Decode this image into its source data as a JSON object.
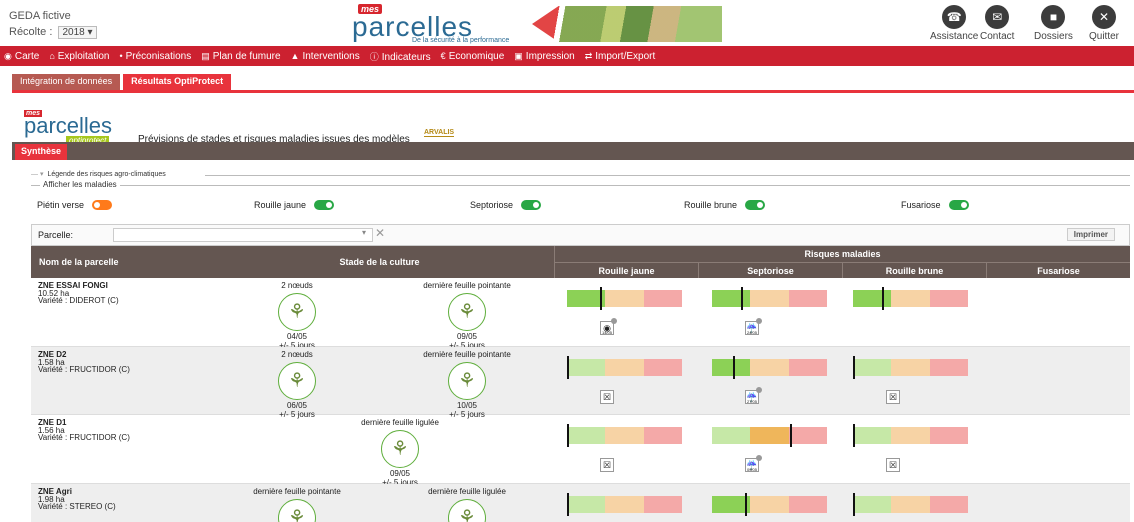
{
  "header": {
    "org": "GEDA fictive",
    "harvest_label": "Récolte :",
    "harvest_value": "2018",
    "brand_mes": "mes",
    "brand_name": "parcelles",
    "tagline": "De la sécurité à la performance",
    "tools": [
      {
        "label": "Assistance",
        "icon": "phone-icon"
      },
      {
        "label": "Contact",
        "icon": "mail-icon"
      },
      {
        "label": "Dossiers",
        "icon": "folder-icon"
      },
      {
        "label": "Quitter",
        "icon": "close-icon"
      }
    ]
  },
  "nav": [
    {
      "label": "Carte",
      "icon": "map-pin-icon"
    },
    {
      "label": "Exploitation",
      "icon": "home-icon"
    },
    {
      "label": "Préconisations",
      "icon": "pin-icon"
    },
    {
      "label": "Plan de fumure",
      "icon": "plan-icon"
    },
    {
      "label": "Interventions",
      "icon": "tractor-icon"
    },
    {
      "label": "Indicateurs",
      "icon": "info-icon"
    },
    {
      "label": "Economique",
      "icon": "euro-icon"
    },
    {
      "label": "Impression",
      "icon": "print-icon"
    },
    {
      "label": "Import/Export",
      "icon": "export-icon"
    }
  ],
  "subtabs": [
    "Intégration de données",
    "Résultats OptiProtect"
  ],
  "opti": {
    "badge": "optiprotect",
    "description": "Prévisions de stades et risques maladies issues des modèles",
    "partner": "ARVALIS"
  },
  "synth_tab": "Synthèse",
  "legend_label": "Légende des risques agro-climatiques",
  "afficher_label": "Afficher les maladies",
  "diseases_toggles": [
    {
      "label": "Piétin verse",
      "on": false
    },
    {
      "label": "Rouille jaune",
      "on": true
    },
    {
      "label": "Septoriose",
      "on": true
    },
    {
      "label": "Rouille brune",
      "on": true
    },
    {
      "label": "Fusariose",
      "on": true
    }
  ],
  "filter": {
    "label": "Parcelle:",
    "print": "Imprimer"
  },
  "table": {
    "col_parcel": "Nom de la parcelle",
    "col_stage": "Stade de la culture",
    "col_risks": "Risques maladies",
    "disease_cols": [
      "Rouille jaune",
      "Septoriose",
      "Rouille brune",
      "Fusariose"
    ]
  },
  "rows": [
    {
      "name": "ZNE ESSAI FONGI",
      "area": "10.52 ha",
      "variety": "Variété : DIDEROT (C)",
      "stages": [
        {
          "label": "2 nœuds",
          "date": "04/05",
          "tol": "+/- 5 jours"
        },
        {
          "label": "dernière feuille pointante",
          "date": "09/05",
          "tol": "+/- 5 jours"
        }
      ],
      "risks": [
        {
          "marker": 0.29,
          "active": 0,
          "icon": "eye-icon",
          "icon_date": "14/05"
        },
        {
          "marker": 0.25,
          "active": 0,
          "icon": "rain-icon",
          "icon_date": "24/05"
        },
        {
          "marker": 0.25,
          "active": 0,
          "icon": "",
          "icon_date": ""
        }
      ]
    },
    {
      "name": "ZNE D2",
      "area": "1.58 ha",
      "variety": "Variété : FRUCTIDOR (C)",
      "stages": [
        {
          "label": "2 nœuds",
          "date": "06/05",
          "tol": "+/- 5 jours"
        },
        {
          "label": "dernière feuille pointante",
          "date": "10/05",
          "tol": "+/- 5 jours"
        }
      ],
      "risks": [
        {
          "marker": 0.0,
          "active": -1,
          "icon": "rain-crossed-icon",
          "icon_date": ""
        },
        {
          "marker": 0.18,
          "active": 0,
          "icon": "rain-icon",
          "icon_date": "27/05"
        },
        {
          "marker": 0.0,
          "active": -1,
          "icon": "rain-crossed-icon",
          "icon_date": ""
        }
      ]
    },
    {
      "name": "ZNE D1",
      "area": "1.56 ha",
      "variety": "Variété : FRUCTIDOR (C)",
      "stages": [
        {
          "label": "dernière feuille ligulée",
          "date": "09/05",
          "tol": "+/- 5 jours"
        }
      ],
      "risks": [
        {
          "marker": 0.0,
          "active": -1,
          "icon": "rain-crossed-icon",
          "icon_date": ""
        },
        {
          "marker": 0.68,
          "active": 1,
          "icon": "rain-icon",
          "icon_date": "09/05"
        },
        {
          "marker": 0.0,
          "active": -1,
          "icon": "rain-crossed-icon",
          "icon_date": ""
        }
      ]
    },
    {
      "name": "ZNE Agri",
      "area": "1.98 ha",
      "variety": "Variété : STEREO (C)",
      "stages": [
        {
          "label": "dernière feuille pointante",
          "date": "",
          "tol": ""
        },
        {
          "label": "dernière feuille ligulée",
          "date": "",
          "tol": ""
        }
      ],
      "risks": [
        {
          "marker": 0.0,
          "active": -1,
          "icon": "",
          "icon_date": ""
        },
        {
          "marker": 0.29,
          "active": 0,
          "icon": "",
          "icon_date": ""
        },
        {
          "marker": 0.0,
          "active": -1,
          "icon": "",
          "icon_date": ""
        }
      ]
    }
  ]
}
